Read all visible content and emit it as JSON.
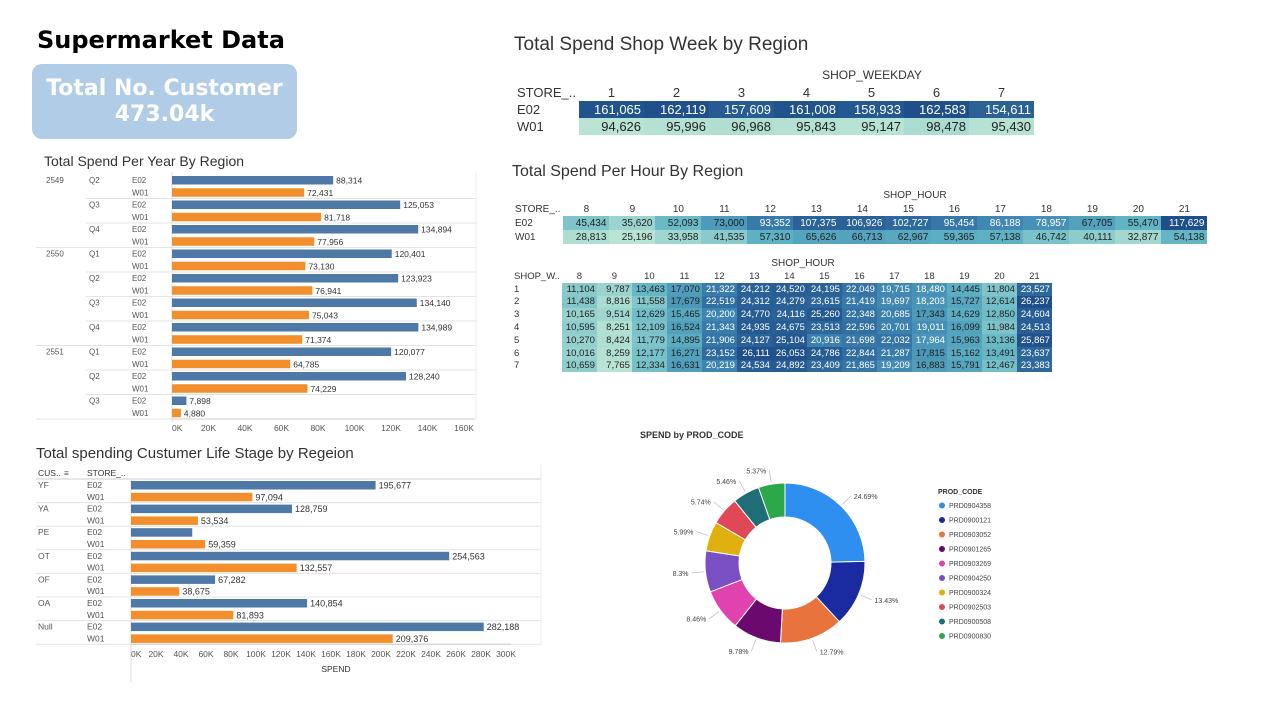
{
  "page": {
    "title": "Supermarket Data"
  },
  "kpi": {
    "label": "Total No. Customer",
    "value": "473.04k"
  },
  "weekday": {
    "title": "Total Spend Shop Week by Region",
    "dim_label": "SHOP_WEEKDAY",
    "row_header": "STORE_..",
    "columns": [
      "1",
      "2",
      "3",
      "4",
      "5",
      "6",
      "7"
    ],
    "rows": [
      {
        "label": "E02",
        "values": [
          "161,065",
          "162,119",
          "157,609",
          "161,008",
          "158,933",
          "162,583",
          "154,611"
        ]
      },
      {
        "label": "W01",
        "values": [
          "94,626",
          "95,996",
          "96,968",
          "95,843",
          "95,147",
          "98,478",
          "95,430"
        ]
      }
    ]
  },
  "hour": {
    "title": "Total Spend Per Hour By Region",
    "dim_label": "SHOP_HOUR",
    "row_header": "STORE_..",
    "columns": [
      "8",
      "9",
      "10",
      "11",
      "12",
      "13",
      "14",
      "15",
      "16",
      "17",
      "18",
      "19",
      "20",
      "21"
    ],
    "rows": [
      {
        "label": "E02",
        "values": [
          "45,434",
          "35,620",
          "52,093",
          "73,000",
          "93,352",
          "107,375",
          "106,926",
          "102,727",
          "95,454",
          "86,188",
          "78,957",
          "67,705",
          "55,470",
          "117,629"
        ]
      },
      {
        "label": "W01",
        "values": [
          "28,813",
          "25,196",
          "33,958",
          "41,535",
          "57,310",
          "65,626",
          "66,713",
          "62,967",
          "59,365",
          "57,138",
          "46,742",
          "40,111",
          "32,877",
          "54,138"
        ]
      }
    ]
  },
  "weekhour": {
    "dim_label": "SHOP_HOUR",
    "row_header": "SHOP_W..",
    "columns": [
      "8",
      "9",
      "10",
      "11",
      "12",
      "13",
      "14",
      "15",
      "16",
      "17",
      "18",
      "19",
      "20",
      "21"
    ],
    "rows": [
      {
        "label": "1",
        "values": [
          "11,104",
          "9,787",
          "13,463",
          "17,070",
          "21,322",
          "24,212",
          "24,520",
          "24,195",
          "22,049",
          "19,715",
          "18,480",
          "14,445",
          "11,804",
          "23,527"
        ]
      },
      {
        "label": "2",
        "values": [
          "11,438",
          "8,816",
          "11,558",
          "17,679",
          "22,519",
          "24,312",
          "24,279",
          "23,615",
          "21,419",
          "19,697",
          "18,203",
          "15,727",
          "12,614",
          "26,237"
        ]
      },
      {
        "label": "3",
        "values": [
          "10,165",
          "9,514",
          "12,629",
          "15,465",
          "20,200",
          "24,770",
          "24,116",
          "25,260",
          "22,348",
          "20,685",
          "17,343",
          "14,629",
          "12,850",
          "24,604"
        ]
      },
      {
        "label": "4",
        "values": [
          "10,595",
          "8,251",
          "12,109",
          "16,524",
          "21,343",
          "24,935",
          "24,675",
          "23,513",
          "22,596",
          "20,701",
          "19,011",
          "16,099",
          "11,984",
          "24,513"
        ]
      },
      {
        "label": "5",
        "values": [
          "10,270",
          "8,424",
          "11,779",
          "14,895",
          "21,906",
          "24,127",
          "25,104",
          "20,916",
          "21,698",
          "22,032",
          "17,964",
          "15,963",
          "13,136",
          "25,867"
        ]
      },
      {
        "label": "6",
        "values": [
          "10,016",
          "8,259",
          "12,177",
          "16,271",
          "23,152",
          "26,111",
          "26,053",
          "24,786",
          "22,844",
          "21,287",
          "17,815",
          "15,162",
          "13,491",
          "23,637"
        ]
      },
      {
        "label": "7",
        "values": [
          "10,659",
          "7,765",
          "12,334",
          "16,631",
          "20,219",
          "24,534",
          "24,892",
          "23,409",
          "21,865",
          "19,209",
          "16,883",
          "15,791",
          "12,467",
          "23,383"
        ]
      }
    ]
  },
  "chart_data": [
    {
      "type": "bar",
      "title": "Total Spend Per Year By Region",
      "xlim": [
        0,
        160000
      ],
      "xticks": [
        "0K",
        "20K",
        "40K",
        "60K",
        "80K",
        "100K",
        "120K",
        "140K",
        "160K"
      ],
      "groups": [
        {
          "year": "2549",
          "quarter": "Q2",
          "rows": [
            {
              "store": "E02",
              "value": 88314,
              "label": "88,314"
            },
            {
              "store": "W01",
              "value": 72431,
              "label": "72,431"
            }
          ]
        },
        {
          "year": "",
          "quarter": "Q3",
          "rows": [
            {
              "store": "E02",
              "value": 125053,
              "label": "125,053"
            },
            {
              "store": "W01",
              "value": 81718,
              "label": "81,718"
            }
          ]
        },
        {
          "year": "",
          "quarter": "Q4",
          "rows": [
            {
              "store": "E02",
              "value": 134894,
              "label": "134,894"
            },
            {
              "store": "W01",
              "value": 77956,
              "label": "77,956"
            }
          ]
        },
        {
          "year": "2550",
          "quarter": "Q1",
          "rows": [
            {
              "store": "E02",
              "value": 120401,
              "label": "120,401"
            },
            {
              "store": "W01",
              "value": 73130,
              "label": "73,130"
            }
          ]
        },
        {
          "year": "",
          "quarter": "Q2",
          "rows": [
            {
              "store": "E02",
              "value": 123923,
              "label": "123,923"
            },
            {
              "store": "W01",
              "value": 76941,
              "label": "76,941"
            }
          ]
        },
        {
          "year": "",
          "quarter": "Q3",
          "rows": [
            {
              "store": "E02",
              "value": 134140,
              "label": "134,140"
            },
            {
              "store": "W01",
              "value": 75043,
              "label": "75,043"
            }
          ]
        },
        {
          "year": "",
          "quarter": "Q4",
          "rows": [
            {
              "store": "E02",
              "value": 134989,
              "label": "134,989"
            },
            {
              "store": "W01",
              "value": 71374,
              "label": "71,374"
            }
          ]
        },
        {
          "year": "2551",
          "quarter": "Q1",
          "rows": [
            {
              "store": "E02",
              "value": 120077,
              "label": "120,077"
            },
            {
              "store": "W01",
              "value": 64785,
              "label": "64,785"
            }
          ]
        },
        {
          "year": "",
          "quarter": "Q2",
          "rows": [
            {
              "store": "E02",
              "value": 128240,
              "label": "128,240"
            },
            {
              "store": "W01",
              "value": 74229,
              "label": "74,229"
            }
          ]
        },
        {
          "year": "",
          "quarter": "Q3",
          "rows": [
            {
              "store": "E02",
              "value": 7898,
              "label": "7,898"
            },
            {
              "store": "W01",
              "value": 4880,
              "label": "4,880"
            }
          ]
        }
      ]
    },
    {
      "type": "bar",
      "title": "Total spending Custumer Life Stage by Regeion",
      "col_headers": [
        "CUS..",
        "STORE_.."
      ],
      "xlabel": "SPEND",
      "xlim": [
        0,
        300000
      ],
      "xticks": [
        "0K",
        "20K",
        "40K",
        "60K",
        "80K",
        "100K",
        "120K",
        "140K",
        "160K",
        "180K",
        "200K",
        "220K",
        "240K",
        "260K",
        "280K",
        "300K"
      ],
      "groups": [
        {
          "stage": "YF",
          "rows": [
            {
              "store": "E02",
              "value": 195677,
              "label": "195,677"
            },
            {
              "store": "W01",
              "value": 97094,
              "label": "97,094"
            }
          ]
        },
        {
          "stage": "YA",
          "rows": [
            {
              "store": "E02",
              "value": 128759,
              "label": "128,759"
            },
            {
              "store": "W01",
              "value": 53534,
              "label": "53,534"
            }
          ]
        },
        {
          "stage": "PE",
          "rows": [
            {
              "store": "E02",
              "value": 49000,
              "label": ""
            },
            {
              "store": "W01",
              "value": 59359,
              "label": "59,359"
            }
          ]
        },
        {
          "stage": "OT",
          "rows": [
            {
              "store": "E02",
              "value": 254563,
              "label": "254,563"
            },
            {
              "store": "W01",
              "value": 132557,
              "label": "132,557"
            }
          ]
        },
        {
          "stage": "OF",
          "rows": [
            {
              "store": "E02",
              "value": 67282,
              "label": "67,282"
            },
            {
              "store": "W01",
              "value": 38675,
              "label": "38,675"
            }
          ]
        },
        {
          "stage": "OA",
          "rows": [
            {
              "store": "E02",
              "value": 140854,
              "label": "140,854"
            },
            {
              "store": "W01",
              "value": 81893,
              "label": "81,893"
            }
          ]
        },
        {
          "stage": "Null",
          "rows": [
            {
              "store": "E02",
              "value": 282188,
              "label": "282,188"
            },
            {
              "store": "W01",
              "value": 209376,
              "label": "209,376"
            }
          ]
        }
      ]
    },
    {
      "type": "pie",
      "title": "SPEND by PROD_CODE",
      "legend_title": "PROD_CODE",
      "slices": [
        {
          "name": "PRD0904358",
          "pct": 24.69,
          "label": "24.69%"
        },
        {
          "name": "PRD0900121",
          "pct": 13.43,
          "label": "13.43%"
        },
        {
          "name": "PRD0903052",
          "pct": 12.79,
          "label": "12.79%"
        },
        {
          "name": "PRD0901265",
          "pct": 9.78,
          "label": "9.78%"
        },
        {
          "name": "PRD0903269",
          "pct": 8.46,
          "label": "8.46%"
        },
        {
          "name": "PRD0904250",
          "pct": 8.3,
          "label": "8.3%"
        },
        {
          "name": "PRD0900324",
          "pct": 5.99,
          "label": "5.99%"
        },
        {
          "name": "PRD0902503",
          "pct": 5.74,
          "label": "5.74%"
        },
        {
          "name": "PRD0900508",
          "pct": 5.46,
          "label": "5.46%"
        },
        {
          "name": "PRD0900830",
          "pct": 5.37,
          "label": "5.37%"
        }
      ]
    }
  ],
  "colors": {
    "e02": "#4e79a7",
    "w01": "#f28e2b",
    "kpi_bg": "#b0cce7",
    "pie": [
      "#2e8ff0",
      "#1a2aa0",
      "#e8733c",
      "#6a0a6e",
      "#e043b0",
      "#7b4fc4",
      "#e0b010",
      "#e04858",
      "#1f6e78",
      "#2ba84a"
    ]
  }
}
